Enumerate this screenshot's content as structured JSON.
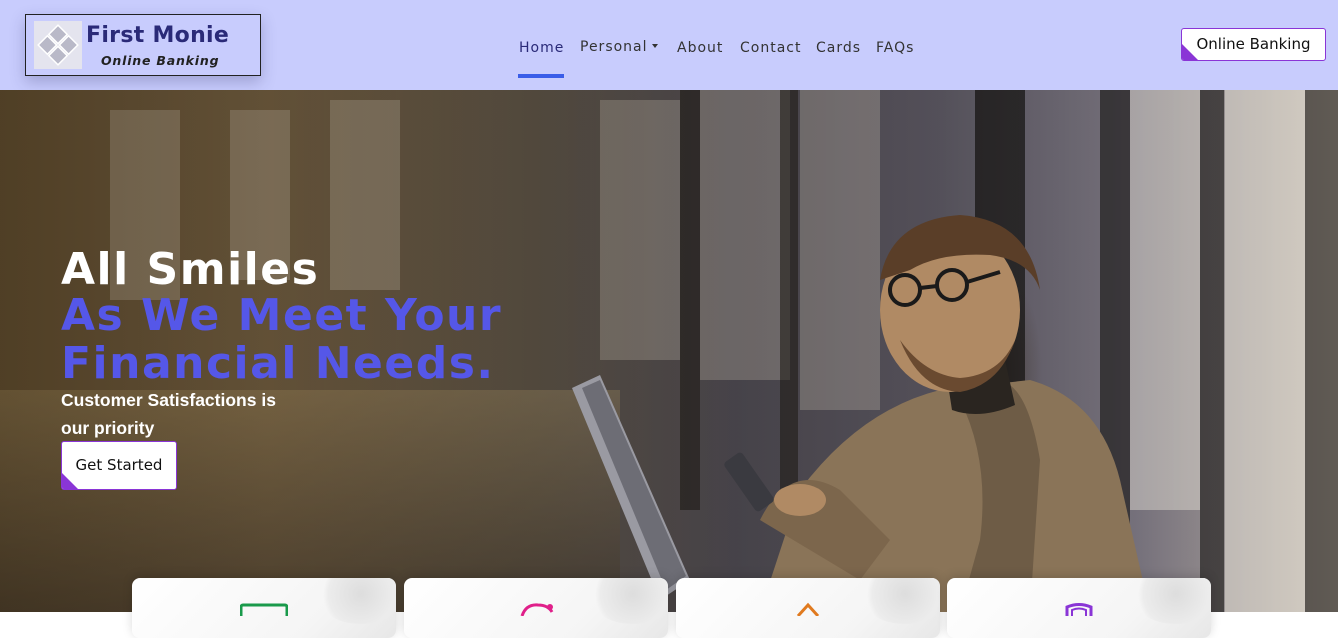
{
  "brand": {
    "title": "First Monie",
    "subtitle": "Online Banking",
    "logo_icon": "diamond-grid-logo"
  },
  "nav": {
    "items": [
      {
        "label": "Home",
        "active": true
      },
      {
        "label": "Personal",
        "dropdown": true
      },
      {
        "label": "About"
      },
      {
        "label": "Contact"
      },
      {
        "label": "Cards"
      },
      {
        "label": "FAQs"
      }
    ],
    "cta_label": "Online Banking"
  },
  "hero": {
    "line1": "All Smiles",
    "line2": "As We Meet Your",
    "line3": "Financial Needs.",
    "subtitle": "Customer Satisfactions is our priority",
    "button_label": "Get Started"
  },
  "feature_cards": [
    {
      "icon": "card-icon",
      "icon_color": "#1a9a4b"
    },
    {
      "icon": "piggy-bank-icon",
      "icon_color": "#e0208a"
    },
    {
      "icon": "home-icon",
      "icon_color": "#e07a1f"
    },
    {
      "icon": "shield-icon",
      "icon_color": "#8a35d6"
    }
  ],
  "colors": {
    "navbar_bg": "#c8ccfd",
    "accent_blue": "#5557e8",
    "accent_purple": "#8a35d6",
    "active_underline": "#3a5de8"
  }
}
